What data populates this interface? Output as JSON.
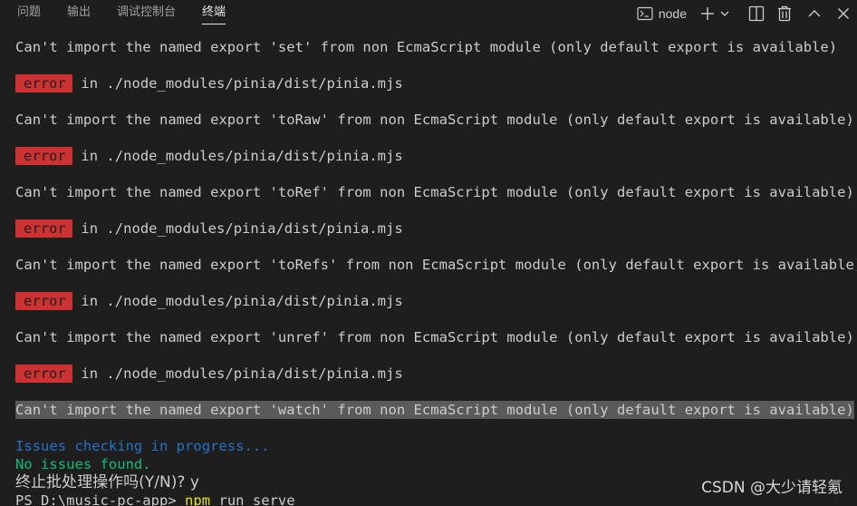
{
  "panel": {
    "tabs": [
      {
        "label": "问题"
      },
      {
        "label": "输出"
      },
      {
        "label": "调试控制台"
      },
      {
        "label": "终端"
      }
    ],
    "active_tab": "终端",
    "terminal_name": "node",
    "icons": {
      "terminal": "terminal-icon",
      "add": "plus-icon",
      "dropdown": "chevron-down-icon",
      "split": "split-icon",
      "trash": "trash-icon",
      "maximize": "chevron-up-icon",
      "close": "close-icon"
    }
  },
  "terminal": {
    "warnings": [
      "Can't import the named export 'set' from non EcmaScript module (only default export is available)",
      "Can't import the named export 'toRaw' from non EcmaScript module (only default export is available)",
      "Can't import the named export 'toRef' from non EcmaScript module (only default export is available)",
      "Can't import the named export 'toRefs' from non EcmaScript module (only default export is available)",
      "Can't import the named export 'unref' from non EcmaScript module (only default export is available)",
      "Can't import the named export 'watch' from non EcmaScript module (only default export is available)"
    ],
    "error_badge": "error",
    "error_path": "in ./node_modules/pinia/dist/pinia.mjs",
    "status_checking": "Issues checking in progress...",
    "status_found": "No issues found.",
    "prompt_terminate": "终止批处理操作吗(Y/N)? y",
    "prompt_path": "PS D:\\music-pc-app> ",
    "prompt_command": "npm",
    "prompt_args": " run serve"
  },
  "colors": {
    "background": "#1e1e1e",
    "error_badge": "#cd3131",
    "status_blue": "#2472c8",
    "status_green": "#0dbc79",
    "command_yellow": "#e5e510",
    "selection": "#5a5a5a"
  },
  "watermark": "CSDN @大少请轻氪"
}
